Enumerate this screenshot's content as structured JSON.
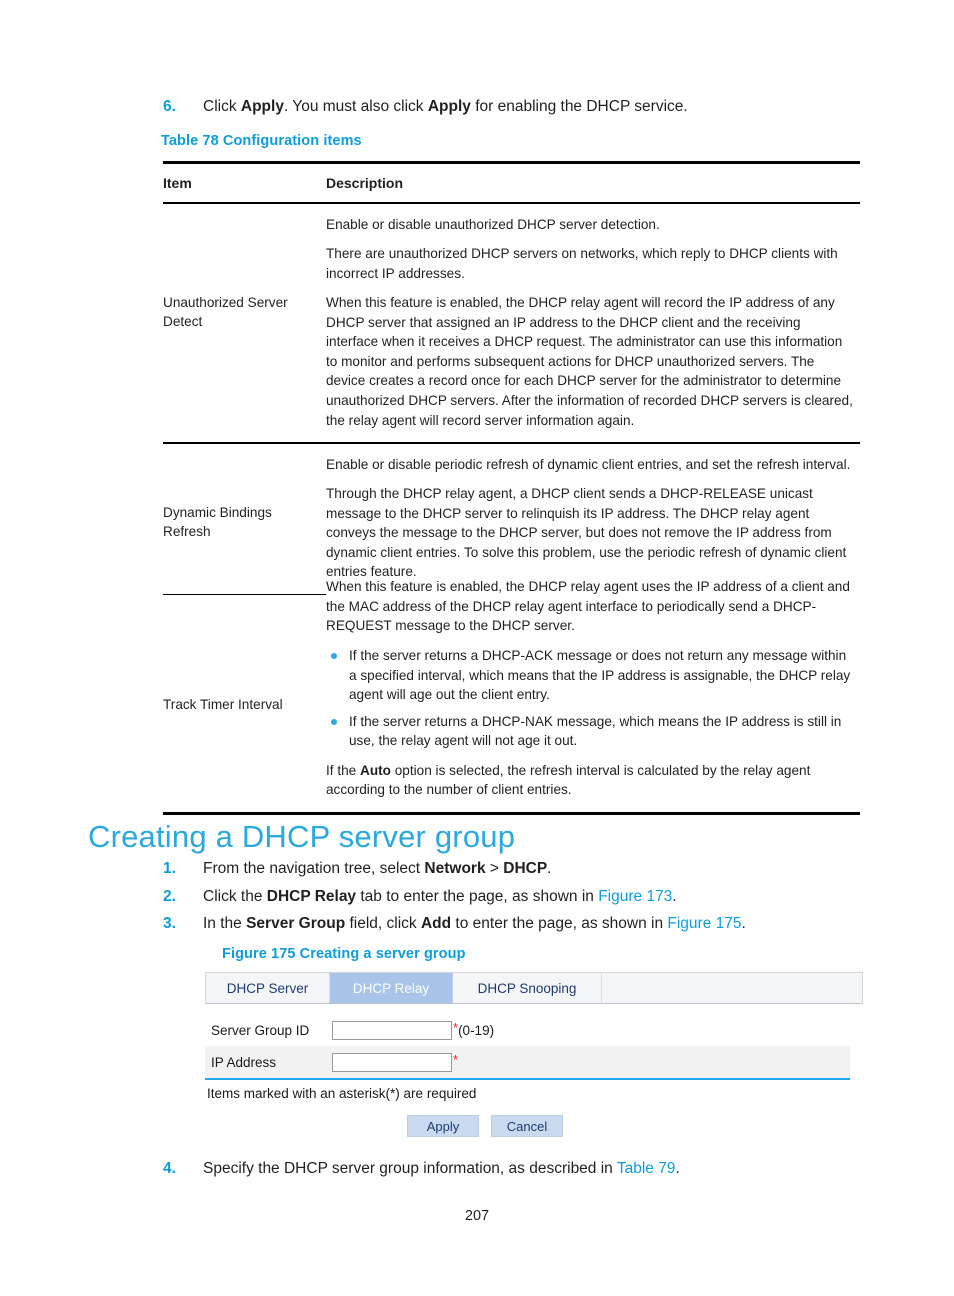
{
  "colors": {
    "accent": "#0d9ddb",
    "heading": "#2aa9e0",
    "bullet": "#29abe2",
    "required_star": "#ea1d24",
    "ui_tab_active_bg": "#a8c4e8",
    "ui_separator": "#22a7f0",
    "ui_button_bg": "#c8d9f0"
  },
  "step6": {
    "number": "6.",
    "text_parts": {
      "a": "Click ",
      "b": "Apply",
      "c": ". You must also click ",
      "d": "Apply",
      "e": " for enabling the DHCP service."
    }
  },
  "table78": {
    "caption": "Table 78 Configuration items",
    "headers": {
      "item": "Item",
      "description": "Description"
    },
    "rows": [
      {
        "item": "Unauthorized Server\nDetect",
        "paragraphs": [
          "Enable or disable unauthorized DHCP server detection.",
          "There are unauthorized DHCP servers on networks, which reply to DHCP clients with incorrect IP addresses.",
          "When this feature is enabled, the DHCP relay agent will record the IP address of any DHCP server that assigned an IP address to the DHCP client and the receiving interface when it receives a DHCP request. The administrator can use this information to monitor and performs subsequent actions for DHCP unauthorized servers. The device creates a record once for each DHCP server for the administrator to determine unauthorized DHCP servers. After the information of recorded DHCP servers is cleared, the relay agent will record server information again."
        ]
      },
      {
        "item": "Dynamic Bindings\nRefresh",
        "paragraphs": [
          "Enable or disable periodic refresh of dynamic client entries, and set the refresh interval.",
          "Through the DHCP relay agent, a DHCP client sends a DHCP-RELEASE unicast message to the DHCP server to relinquish its IP address. The DHCP relay agent conveys the message to the DHCP server, but does not remove the IP address from dynamic client entries. To solve this problem, use the periodic refresh of dynamic client entries feature."
        ]
      },
      {
        "item": "Track Timer Interval",
        "intro": "When this feature is enabled, the DHCP relay agent uses the IP address of a client and the MAC address of the DHCP relay agent interface to periodically send a DHCP-REQUEST message to the DHCP server.",
        "bullets": [
          "If the server returns a DHCP-ACK message or does not return any message within a specified interval, which means that the IP address is assignable, the DHCP relay agent will age out the client entry.",
          "If the server returns a DHCP-NAK message, which means the IP address is still in use, the relay agent will not age it out."
        ],
        "outro_parts": {
          "a": "If the ",
          "b": "Auto",
          "c": " option is selected, the refresh interval is calculated by the relay agent according to the number of client entries."
        }
      }
    ]
  },
  "section": {
    "heading": "Creating a DHCP server group",
    "steps": [
      {
        "number": "1.",
        "parts": [
          {
            "t": "From the navigation tree, select ",
            "style": "normal"
          },
          {
            "t": "Network",
            "style": "bold"
          },
          {
            "t": " > ",
            "style": "normal"
          },
          {
            "t": "DHCP",
            "style": "bold"
          },
          {
            "t": ".",
            "style": "normal"
          }
        ]
      },
      {
        "number": "2.",
        "parts": [
          {
            "t": "Click the ",
            "style": "normal"
          },
          {
            "t": "DHCP Relay",
            "style": "bold"
          },
          {
            "t": " tab to enter the page, as shown in ",
            "style": "normal"
          },
          {
            "t": "Figure 173",
            "style": "link"
          },
          {
            "t": ".",
            "style": "normal"
          }
        ]
      },
      {
        "number": "3.",
        "parts": [
          {
            "t": "In the ",
            "style": "normal"
          },
          {
            "t": "Server Group",
            "style": "bold"
          },
          {
            "t": " field, click ",
            "style": "normal"
          },
          {
            "t": "Add",
            "style": "bold"
          },
          {
            "t": " to enter the page, as shown in ",
            "style": "normal"
          },
          {
            "t": "Figure 175",
            "style": "link"
          },
          {
            "t": ".",
            "style": "normal"
          }
        ]
      },
      {
        "number": "4.",
        "parts": [
          {
            "t": "Specify the DHCP server group information, as described in ",
            "style": "normal"
          },
          {
            "t": "Table 79",
            "style": "link"
          },
          {
            "t": ".",
            "style": "normal"
          }
        ]
      }
    ]
  },
  "figure175": {
    "caption": "Figure 175 Creating a server group",
    "tabs": [
      {
        "label": "DHCP Server",
        "active": false
      },
      {
        "label": "DHCP Relay",
        "active": true
      },
      {
        "label": "DHCP Snooping",
        "active": false
      }
    ],
    "fields": [
      {
        "label": "Server Group ID",
        "value": "",
        "required_mark": "*",
        "hint": "(0-19)"
      },
      {
        "label": "IP Address",
        "value": "",
        "required_mark": "*",
        "hint": ""
      }
    ],
    "note": "Items marked with an asterisk(*) are required",
    "buttons": {
      "apply": "Apply",
      "cancel": "Cancel"
    }
  },
  "footer": {
    "page_number": "207"
  }
}
